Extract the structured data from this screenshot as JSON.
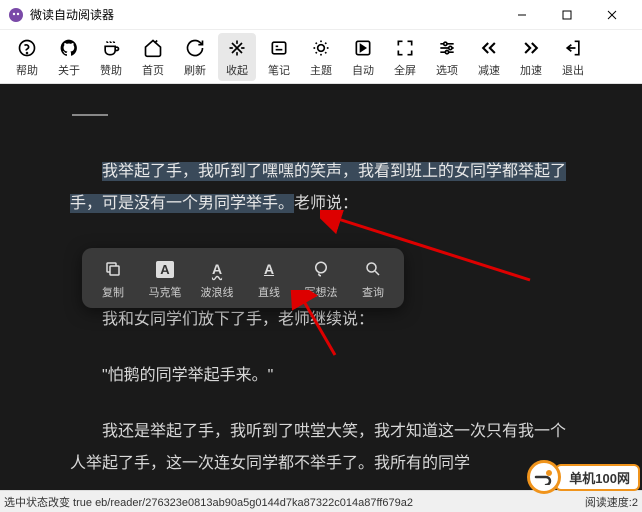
{
  "window": {
    "title": "微读自动阅读器"
  },
  "toolbar": [
    {
      "id": "help",
      "label": "帮助"
    },
    {
      "id": "about",
      "label": "关于"
    },
    {
      "id": "donate",
      "label": "赞助"
    },
    {
      "id": "home",
      "label": "首页"
    },
    {
      "id": "refresh",
      "label": "刷新"
    },
    {
      "id": "collapse",
      "label": "收起",
      "active": true
    },
    {
      "id": "notes",
      "label": "笔记"
    },
    {
      "id": "theme",
      "label": "主题"
    },
    {
      "id": "auto",
      "label": "自动"
    },
    {
      "id": "fullscreen",
      "label": "全屏"
    },
    {
      "id": "options",
      "label": "选项"
    },
    {
      "id": "slower",
      "label": "减速"
    },
    {
      "id": "faster",
      "label": "加速"
    },
    {
      "id": "exit",
      "label": "退出"
    }
  ],
  "content": {
    "p1_highlight": "我举起了手，我听到了嘿嘿的笑声，我看到班上的女同学都举起了手，可是没有一个男同学举手。",
    "p1_rest": "老师说：",
    "p2": "我和女同学们放下了手，老师继续说：",
    "p3": "\"怕鹅的同学举起手来。\"",
    "p4": "我还是举起了手，我听到了哄堂大笑，我才知道这一次只有我一个人举起了手，这一次连女同学都不举手了。我所有的同学"
  },
  "popup": [
    {
      "id": "copy",
      "label": "复制"
    },
    {
      "id": "marker",
      "label": "马克笔"
    },
    {
      "id": "wavy",
      "label": "波浪线"
    },
    {
      "id": "line",
      "label": "直线"
    },
    {
      "id": "thought",
      "label": "写想法"
    },
    {
      "id": "search",
      "label": "查询"
    }
  ],
  "status": {
    "left": "选中状态改变 true eb/reader/276323e0813ab90a5g0144d7ka87322c014a87ff679a2",
    "right": "阅读速度:2"
  },
  "watermark": {
    "text": "单机100网"
  }
}
